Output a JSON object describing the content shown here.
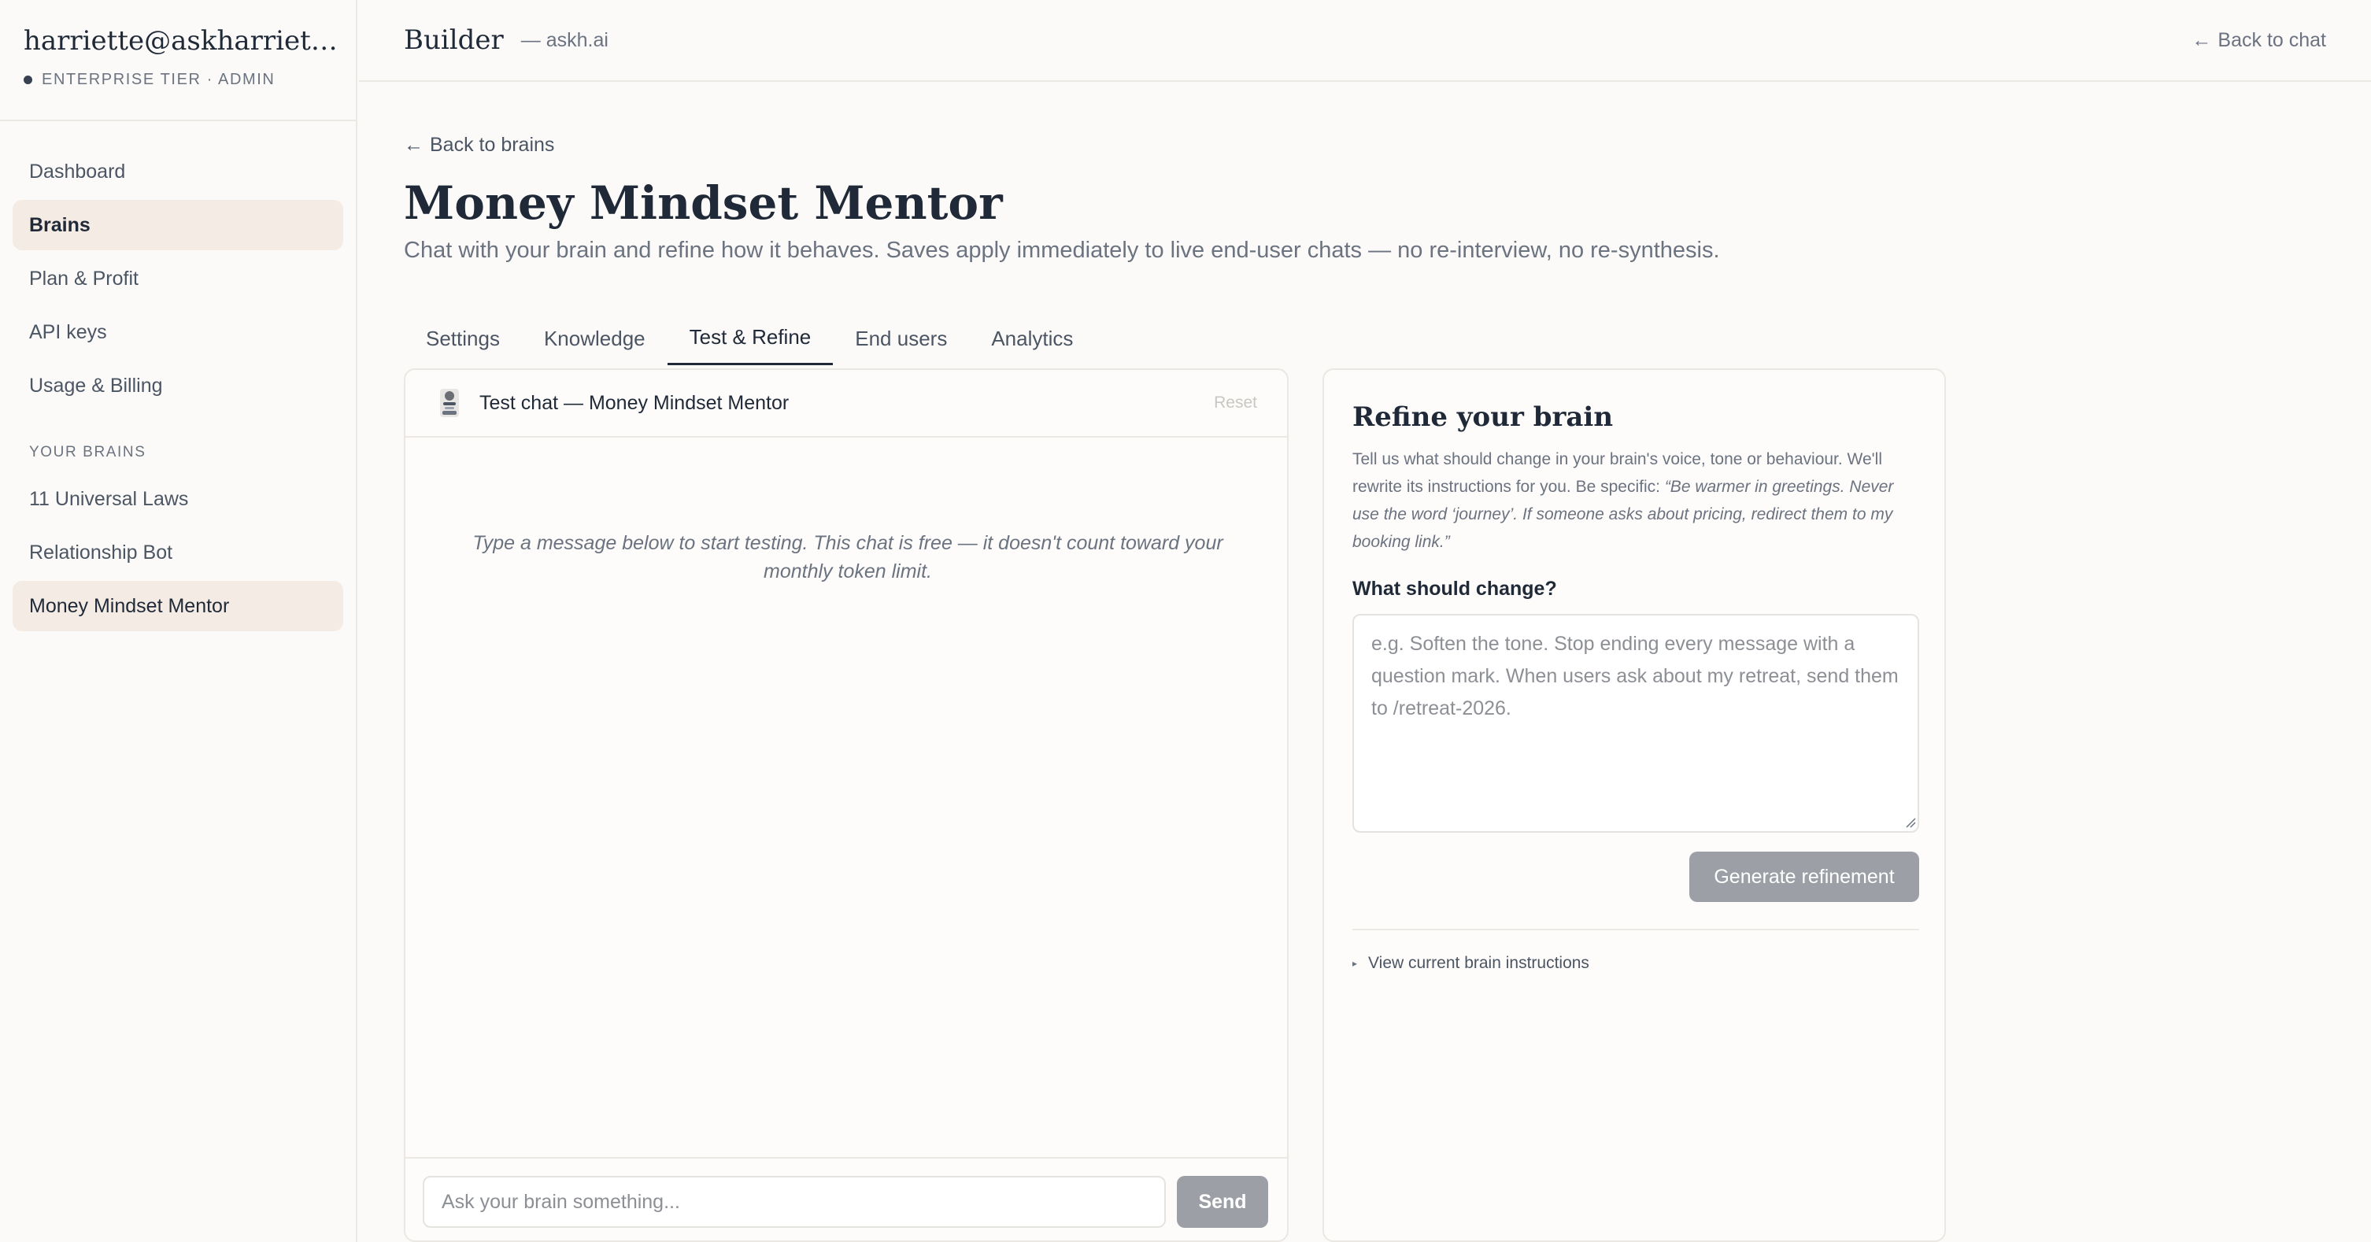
{
  "sidebar": {
    "account_email": "harriette@askharriette.c...",
    "account_tier": "ENTERPRISE TIER · ADMIN",
    "nav_items": [
      {
        "label": "Dashboard"
      },
      {
        "label": "Brains"
      },
      {
        "label": "Plan & Profit"
      },
      {
        "label": "API keys"
      },
      {
        "label": "Usage & Billing"
      }
    ],
    "brains_section_label": "YOUR BRAINS",
    "brains": [
      {
        "label": "11 Universal Laws"
      },
      {
        "label": "Relationship Bot"
      },
      {
        "label": "Money Mindset Mentor"
      }
    ]
  },
  "topbar": {
    "title": "Builder",
    "domain": "— askh.ai",
    "back_label": "Back to chat",
    "back_arrow": "←"
  },
  "main": {
    "back_label": "Back to brains",
    "back_arrow": "←",
    "title": "Money Mindset Mentor",
    "subtitle": "Chat with your brain and refine how it behaves. Saves apply immediately to live end-user chats — no re-interview, no re-synthesis.",
    "tabs": [
      {
        "label": "Settings"
      },
      {
        "label": "Knowledge"
      },
      {
        "label": "Test & Refine"
      },
      {
        "label": "End users"
      },
      {
        "label": "Analytics"
      }
    ],
    "active_tab": "Test & Refine"
  },
  "chat": {
    "title": "Test chat — Money Mindset Mentor",
    "reset_label": "Reset",
    "empty_message": "Type a message below to start testing. This chat is free — it doesn't count toward your monthly token limit.",
    "input_placeholder": "Ask your brain something...",
    "send_label": "Send"
  },
  "refine": {
    "title": "Refine your brain",
    "description_plain": "Tell us what should change in your brain's voice, tone or behaviour. We'll rewrite its instructions for you. Be specific: ",
    "description_example": "“Be warmer in greetings. Never use the word ‘journey’. If someone asks about pricing, redirect them to my booking link.”",
    "field_label": "What should change?",
    "field_placeholder": "e.g. Soften the tone. Stop ending every message with a question mark. When users ask about my retreat, send them to /retreat-2026.",
    "generate_label": "Generate refinement",
    "view_instructions_label": "View current brain instructions"
  },
  "colors": {
    "background": "#fbfaf8",
    "active_nav_bg": "#f4ece4",
    "button_disabled": "#9ca0a6",
    "text_primary": "#1f2937",
    "text_muted": "#6b7280"
  },
  "icons": {
    "avatar": "brain-avatar-icon",
    "back": "arrow-left-icon",
    "disclosure": "triangle-right-icon",
    "tier": "dot-icon"
  }
}
